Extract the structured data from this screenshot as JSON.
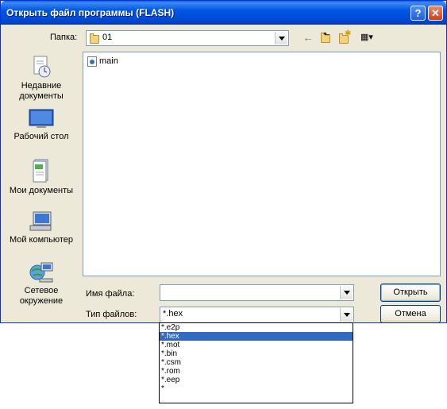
{
  "window": {
    "title": "Открыть файл программы (FLASH)",
    "help_label": "?",
    "close_label": "✕"
  },
  "lookin": {
    "label": "Папка:",
    "value": "01",
    "folder_icon": "folder-icon"
  },
  "toolbar": {
    "back_glyph": "←",
    "up_glyph": "⬑",
    "new_folder_glyph": "✱",
    "view_glyph": "▦▾"
  },
  "places": [
    {
      "label": "Недавние документы",
      "icon": "recent-documents-icon"
    },
    {
      "label": "Рабочий стол",
      "icon": "desktop-icon"
    },
    {
      "label": "Мои документы",
      "icon": "my-documents-icon"
    },
    {
      "label": "Мой компьютер",
      "icon": "my-computer-icon"
    },
    {
      "label": "Сетевое окружение",
      "icon": "network-icon"
    }
  ],
  "files": [
    {
      "name": "main",
      "icon": "program-file-icon"
    }
  ],
  "filename": {
    "label": "Имя файла:",
    "value": ""
  },
  "filetype": {
    "label": "Тип файлов:",
    "value": "*.hex",
    "options": [
      "*.e2p",
      "*.hex",
      "*.mot",
      "*.bin",
      "*.csm",
      "*.rom",
      "*.eep",
      "*"
    ],
    "selected_index": 1
  },
  "buttons": {
    "open": "Открыть",
    "cancel": "Отмена"
  },
  "colors": {
    "title_bar": "#0054e3",
    "selection": "#316ac5",
    "dialog_bg": "#ece9d8"
  }
}
